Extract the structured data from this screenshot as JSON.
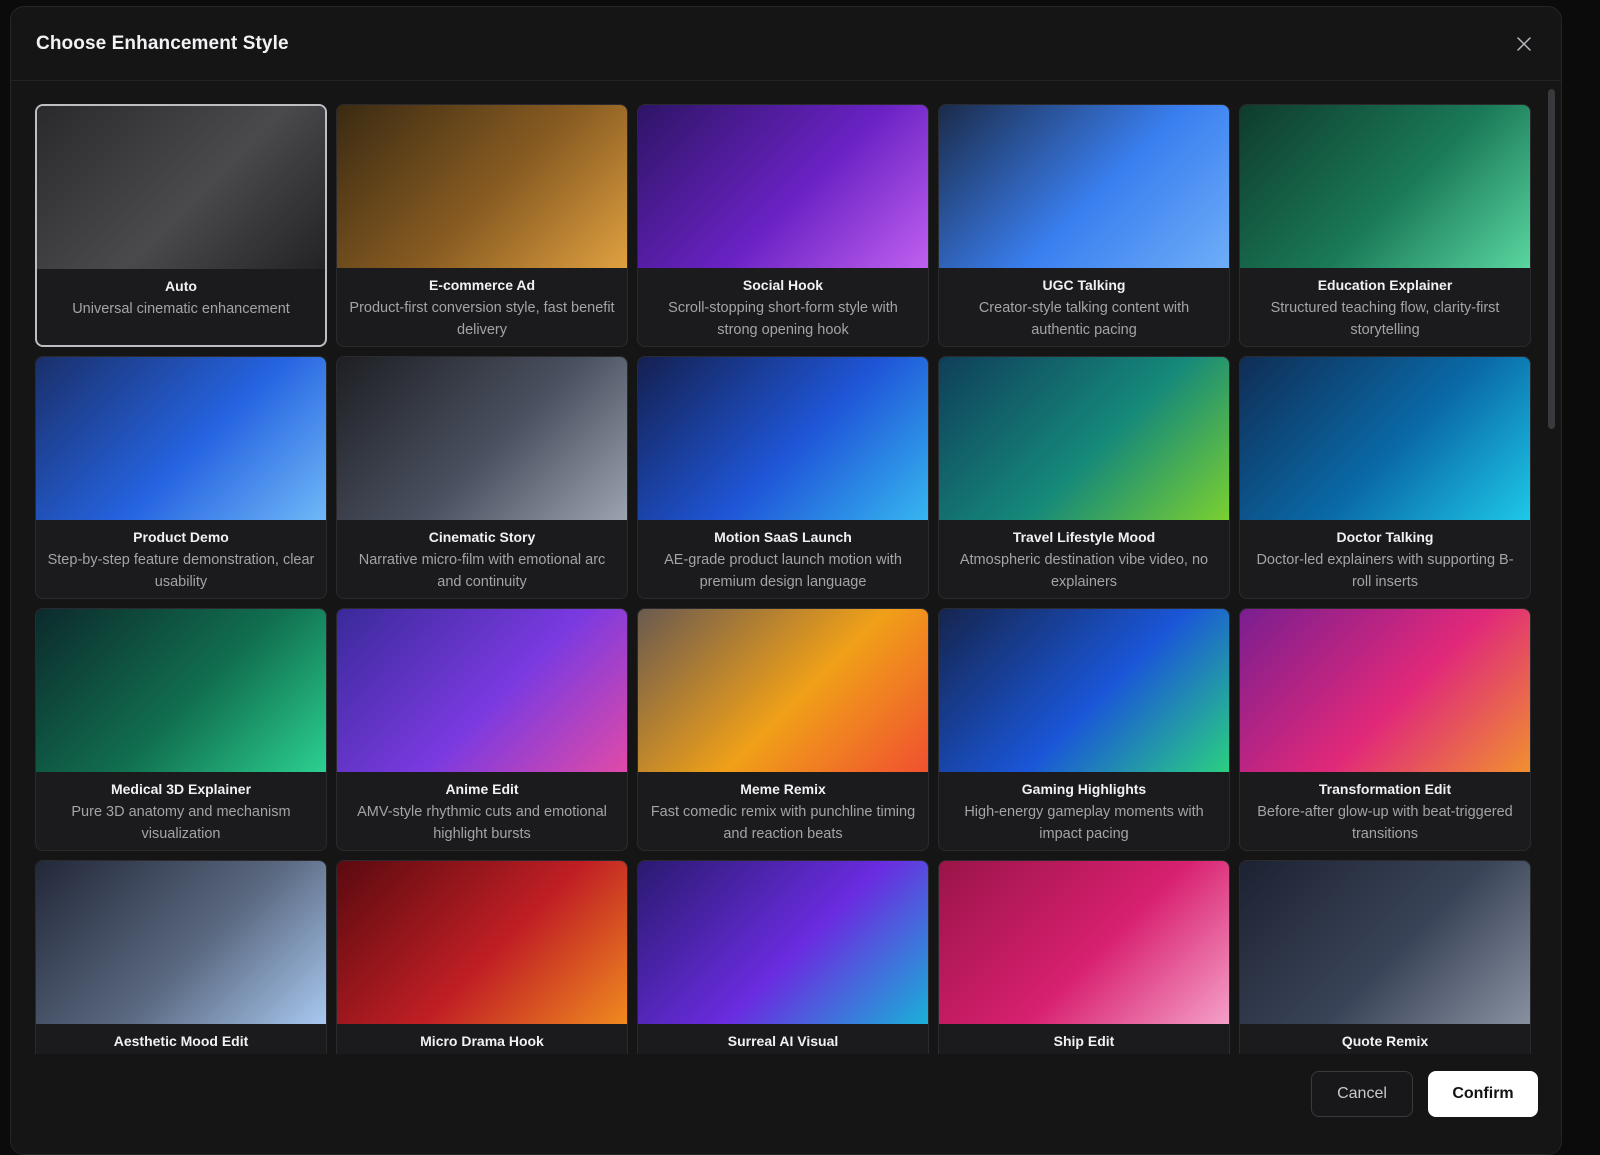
{
  "dialog": {
    "title": "Choose Enhancement Style",
    "cancel_label": "Cancel",
    "confirm_label": "Confirm",
    "selected_style": "Auto"
  },
  "styles": [
    {
      "name": "Auto",
      "description": "Universal cinematic enhancement",
      "gradient": [
        "#2a2a2c",
        "#4a4a4d",
        "#232325"
      ],
      "selected": true
    },
    {
      "name": "E-commerce Ad",
      "description": "Product-first conversion style, fast benefit delivery",
      "gradient": [
        "#3a2a12",
        "#8a5d22",
        "#e0a040"
      ]
    },
    {
      "name": "Social Hook",
      "description": "Scroll-stopping short-form style with strong opening hook",
      "gradient": [
        "#2e1466",
        "#6a22c4",
        "#c060f0"
      ]
    },
    {
      "name": "UGC Talking",
      "description": "Creator-style talking content with authentic pacing",
      "gradient": [
        "#1b2b4a",
        "#3a7ff0",
        "#6eaef8"
      ]
    },
    {
      "name": "Education Explainer",
      "description": "Structured teaching flow, clarity-first storytelling",
      "gradient": [
        "#0f3b2c",
        "#1a7a58",
        "#5ad6a0"
      ]
    },
    {
      "name": "Product Demo",
      "description": "Step-by-step feature demonstration, clear usability",
      "gradient": [
        "#1a2f6a",
        "#2563e0",
        "#70b8f8"
      ]
    },
    {
      "name": "Cinematic Story",
      "description": "Narrative micro-film with emotional arc and continuity",
      "gradient": [
        "#1e1f24",
        "#4a5160",
        "#9ca3b0"
      ]
    },
    {
      "name": "Motion SaaS Launch",
      "description": "AE-grade product launch motion with premium design language",
      "gradient": [
        "#142050",
        "#1f56d8",
        "#36b6f0"
      ]
    },
    {
      "name": "Travel Lifestyle Mood",
      "description": "Atmospheric destination vibe video, no explainers",
      "gradient": [
        "#0f3e5a",
        "#15897a",
        "#7ad030"
      ]
    },
    {
      "name": "Doctor Talking",
      "description": "Doctor-led explainers with supporting B-roll inserts",
      "gradient": [
        "#0f2d55",
        "#0a6aa8",
        "#1ec8e8"
      ]
    },
    {
      "name": "Medical 3D Explainer",
      "description": "Pure 3D anatomy and mechanism visualization",
      "gradient": [
        "#0c2a2c",
        "#117050",
        "#2cd090"
      ]
    },
    {
      "name": "Anime Edit",
      "description": "AMV-style rhythmic cuts and emotional highlight bursts",
      "gradient": [
        "#3a2a9a",
        "#7a3ae0",
        "#e04aa8"
      ]
    },
    {
      "name": "Meme Remix",
      "description": "Fast comedic remix with punchline timing and reaction beats",
      "gradient": [
        "#6a5a50",
        "#f0a018",
        "#f05030"
      ]
    },
    {
      "name": "Gaming Highlights",
      "description": "High-energy gameplay moments with impact pacing",
      "gradient": [
        "#15254e",
        "#1a56d8",
        "#2ad080"
      ]
    },
    {
      "name": "Transformation Edit",
      "description": "Before-after glow-up with beat-triggered transitions",
      "gradient": [
        "#7a1e90",
        "#e0287a",
        "#f09030"
      ]
    },
    {
      "name": "Aesthetic Mood Edit",
      "description": "",
      "gradient": [
        "#222838",
        "#5a6880",
        "#a8c8f0"
      ]
    },
    {
      "name": "Micro Drama Hook",
      "description": "",
      "gradient": [
        "#5a0a10",
        "#c01f24",
        "#f08a20"
      ]
    },
    {
      "name": "Surreal AI Visual",
      "description": "",
      "gradient": [
        "#2a1a70",
        "#6a2ce0",
        "#1ab0d8"
      ]
    },
    {
      "name": "Ship Edit",
      "description": "",
      "gradient": [
        "#9a1448",
        "#d82070",
        "#f4a0c8"
      ]
    },
    {
      "name": "Quote Remix",
      "description": "",
      "gradient": [
        "#1c2232",
        "#3a4458",
        "#8890a0"
      ]
    }
  ]
}
